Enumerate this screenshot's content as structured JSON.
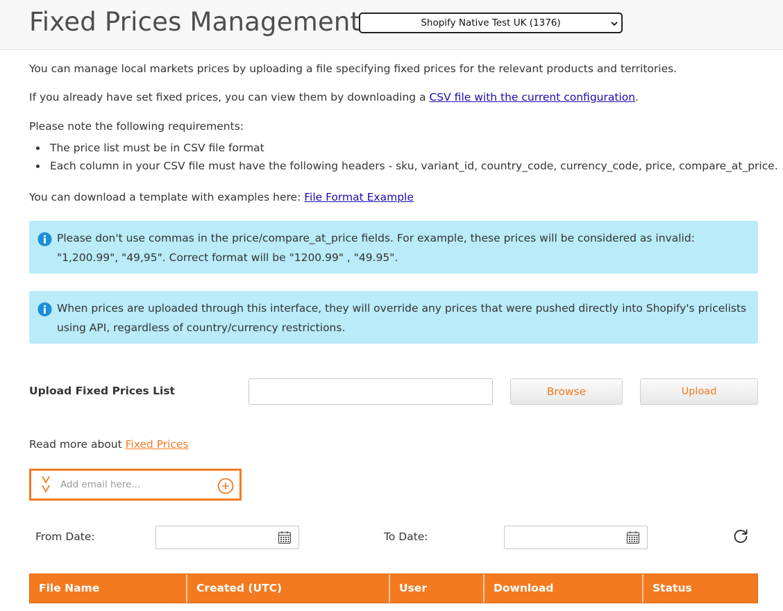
{
  "header": {
    "title": "Fixed Prices Management",
    "store_select": {
      "selected": "Shopify Native Test UK (1376)"
    }
  },
  "intro": {
    "line1": "You can manage local markets prices by uploading a file specifying fixed prices for the relevant products and territories.",
    "line2_prefix": "If you already have set fixed prices, you can view them by downloading a ",
    "line2_link": "CSV file with the current configuration",
    "line2_suffix": ".",
    "requirements_heading": "Please note the following requirements:",
    "requirements": [
      "The price list must be in CSV file format",
      "Each column in your CSV file must have the following headers - sku, variant_id, country_code, currency_code, price, compare_at_price."
    ],
    "template_prefix": "You can download a template with examples here: ",
    "template_link": "File Format Example"
  },
  "alerts": [
    {
      "icon": "info-icon",
      "text": "Please don't use commas in the price/compare_at_price fields. For example, these prices will be considered as invalid: \"1,200.99\", \"49,95\". Correct format will be \"1200.99\" , \"49.95\"."
    },
    {
      "icon": "info-icon",
      "text": "When prices are uploaded through this interface, they will override any prices that were pushed directly into Shopify's pricelists using API, regardless of country/currency restrictions."
    }
  ],
  "upload": {
    "label": "Upload Fixed Prices List",
    "file_value": "",
    "browse_label": "Browse",
    "upload_label": "Upload"
  },
  "read_more": {
    "prefix": "Read more about ",
    "link": "Fixed Prices"
  },
  "email": {
    "placeholder": "Add email here...",
    "value": "",
    "icon": "chevrons-down-icon",
    "add_icon": "plus-circle-icon"
  },
  "filters": {
    "from_label": "From Date:",
    "to_label": "To Date:",
    "from_value": "",
    "to_value": "",
    "calendar_icon": "calendar-icon",
    "refresh_icon": "refresh-icon"
  },
  "table": {
    "columns": [
      "File Name",
      "Created (UTC)",
      "User",
      "Download",
      "Status"
    ]
  },
  "colors": {
    "accent": "#f47a20",
    "alert_bg": "#b9ebf9",
    "info_icon": "#1b8fd8",
    "link": "#1a0dab"
  }
}
